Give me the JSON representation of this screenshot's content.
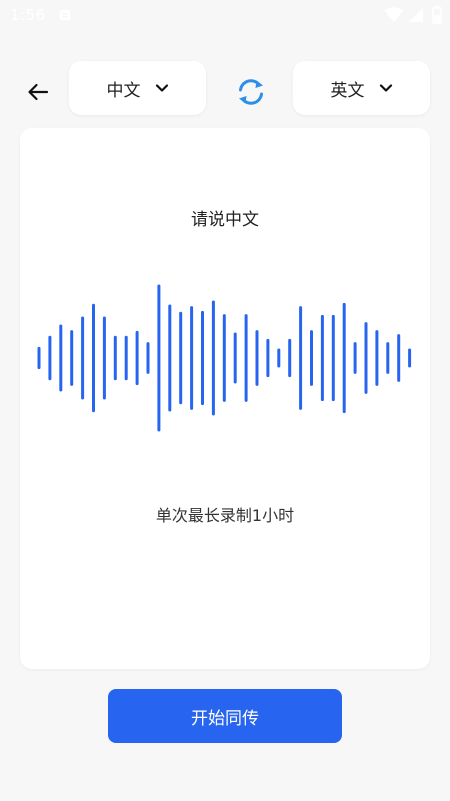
{
  "status_bar": {
    "time": "1:56",
    "icons": [
      "notification-icon",
      "wifi-icon",
      "signal-icon",
      "battery-icon"
    ]
  },
  "header": {
    "back_icon": "arrow-left-icon",
    "source_language": "中文",
    "target_language": "英文",
    "swap_icon": "swap-refresh-icon"
  },
  "card": {
    "prompt": "请说中文",
    "recording_limit": "单次最长录制1小时"
  },
  "waveform": {
    "color": "#2764f0",
    "levels": [
      0.12,
      0.26,
      0.4,
      0.33,
      0.5,
      0.66,
      0.5,
      0.26,
      0.26,
      0.32,
      0.18,
      0.9,
      0.65,
      0.56,
      0.63,
      0.57,
      0.7,
      0.53,
      0.3,
      0.53,
      0.33,
      0.22,
      0.1,
      0.22,
      0.63,
      0.33,
      0.52,
      0.52,
      0.67,
      0.18,
      0.43,
      0.33,
      0.18,
      0.28,
      0.1
    ]
  },
  "actions": {
    "start_label": "开始同传"
  },
  "colors": {
    "accent": "#2764f0",
    "swap_icon": "#2e8fe6",
    "background": "#f7f7f8",
    "card": "#ffffff"
  }
}
